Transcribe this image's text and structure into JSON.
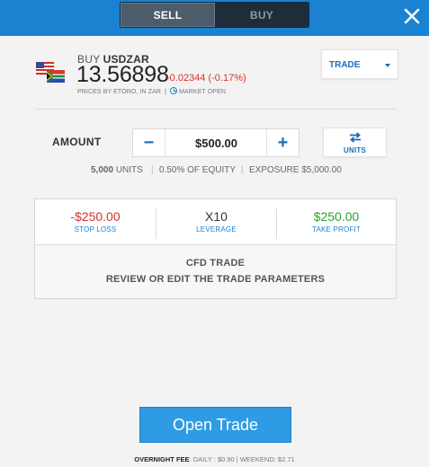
{
  "toggle": {
    "sell_label": "SELL",
    "buy_label": "BUY",
    "selected": "SELL"
  },
  "header": {
    "action": "BUY",
    "symbol": "USDZAR",
    "price": "13.56898",
    "change": "-0.02344 (-0.17%)",
    "price_source": "PRICES BY ETORO, IN ZAR",
    "market_status": "MARKET OPEN",
    "order_type": "TRADE"
  },
  "amount": {
    "label": "AMOUNT",
    "value": "$500.00",
    "toggle_label": "UNITS",
    "units_value": "5,000",
    "units_label": "UNITS",
    "equity": "0.50% OF EQUITY",
    "exposure_label": "EXPOSURE",
    "exposure_value": "$5,000.00"
  },
  "params": {
    "stop_loss_value": "-$250.00",
    "stop_loss_label": "STOP LOSS",
    "leverage_value": "X10",
    "leverage_label": "LEVERAGE",
    "take_profit_value": "$250.00",
    "take_profit_label": "TAKE PROFIT",
    "title": "CFD TRADE",
    "subtitle": "REVIEW OR EDIT THE TRADE PARAMETERS"
  },
  "footer": {
    "open_trade_label": "Open Trade",
    "fee_label": "OVERNIGHT FEE",
    "fee_details": ": DAILY : $0.90 | WEEKEND: $2.71"
  },
  "colors": {
    "brand_blue": "#1a82d1",
    "button_blue": "#2e9be4",
    "negative": "#d9302c",
    "positive": "#2aa22a"
  }
}
